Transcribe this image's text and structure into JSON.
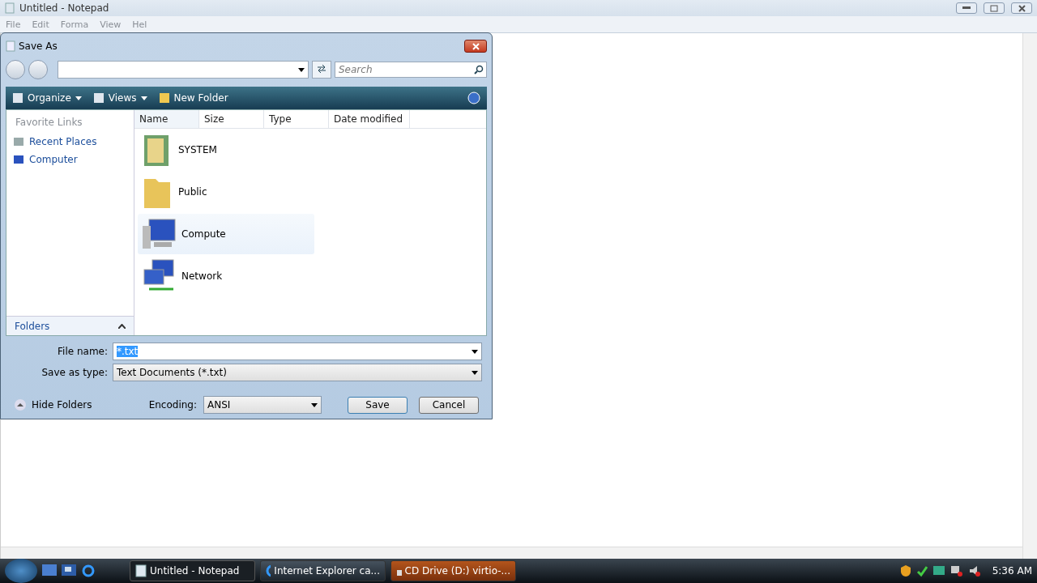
{
  "notepad": {
    "title": "Untitled - Notepad",
    "menu": [
      "File",
      "Edit",
      "Forma",
      "View",
      "Hel"
    ]
  },
  "dialog": {
    "title": "Save As",
    "search": {
      "placeholder": "Search"
    },
    "toolbar": [
      {
        "label": "Organize",
        "kind": "menu"
      },
      {
        "label": "Views",
        "kind": "menu"
      },
      {
        "label": "New Folder",
        "kind": "plain"
      }
    ],
    "sidebar": {
      "heading": "Favorite Links",
      "links": [
        {
          "label": "Recent Places",
          "kind": "places"
        },
        {
          "label": "Computer",
          "kind": "computer"
        }
      ],
      "folders_label": "Folders"
    },
    "columns": [
      "Name",
      "Size",
      "Type",
      "Date modified"
    ],
    "items": [
      {
        "name": "SYSTEM",
        "kind": "system",
        "hovered": false
      },
      {
        "name": "Public",
        "kind": "folder",
        "hovered": false
      },
      {
        "name": "Compute",
        "kind": "computer",
        "hovered": true
      },
      {
        "name": "Network",
        "kind": "network",
        "hovered": false
      }
    ],
    "file_name": {
      "label": "File name:",
      "value": "*.txt"
    },
    "save_type": {
      "label": "Save as type:",
      "value": "Text Documents (*.txt)"
    },
    "hide_folders": "Hide Folders",
    "encoding": {
      "label": "Encoding:",
      "value": "ANSI"
    },
    "buttons": [
      {
        "label": "Save",
        "default": true
      },
      {
        "label": "Cancel",
        "default": false
      }
    ]
  },
  "taskbar": {
    "tasks": [
      {
        "label": "Untitled - Notepad",
        "kind": "notepad",
        "selected": true
      },
      {
        "label": "Internet Explorer ca...",
        "kind": "ie",
        "selected": false
      },
      {
        "label": "CD Drive (D:) virtio-...",
        "kind": "drive",
        "selected": false
      }
    ],
    "clock": "5:36 AM"
  }
}
